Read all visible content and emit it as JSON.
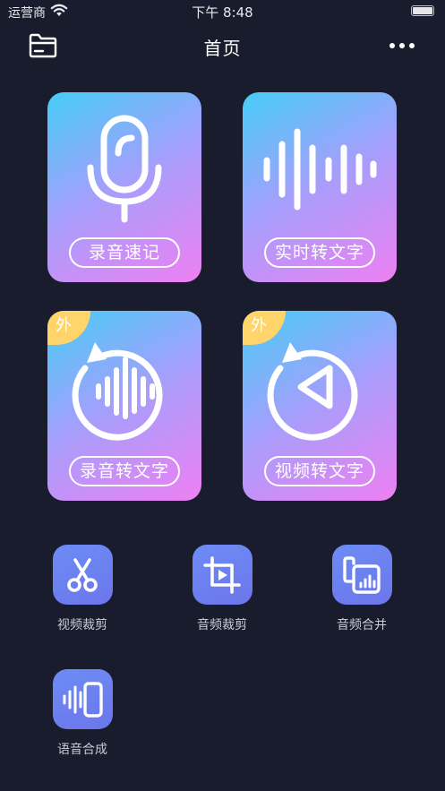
{
  "status_bar": {
    "carrier": "运营商",
    "time": "下午 8:48"
  },
  "nav": {
    "title": "首页",
    "folder_icon": "folder-icon",
    "more_icon": "more-icon"
  },
  "cards": [
    {
      "label": "录音速记",
      "icon": "microphone-icon",
      "badge": ""
    },
    {
      "label": "实时转文字",
      "icon": "sound-wave-icon",
      "badge": ""
    },
    {
      "label": "录音转文字",
      "icon": "audio-replay-icon",
      "badge": "外"
    },
    {
      "label": "视频转文字",
      "icon": "video-replay-icon",
      "badge": "外"
    }
  ],
  "tools": [
    {
      "label": "视频裁剪",
      "icon": "scissors-icon"
    },
    {
      "label": "音频裁剪",
      "icon": "crop-icon"
    },
    {
      "label": "音频合并",
      "icon": "merge-icon"
    },
    {
      "label": "语音合成",
      "icon": "voice-synthesis-icon"
    }
  ],
  "colors": {
    "background": "#181c2c",
    "card_gradient_start": "#46cdf7",
    "card_gradient_end": "#ee80f2",
    "badge": "#ffd46a",
    "tool_icon": "#6c7ff0"
  }
}
